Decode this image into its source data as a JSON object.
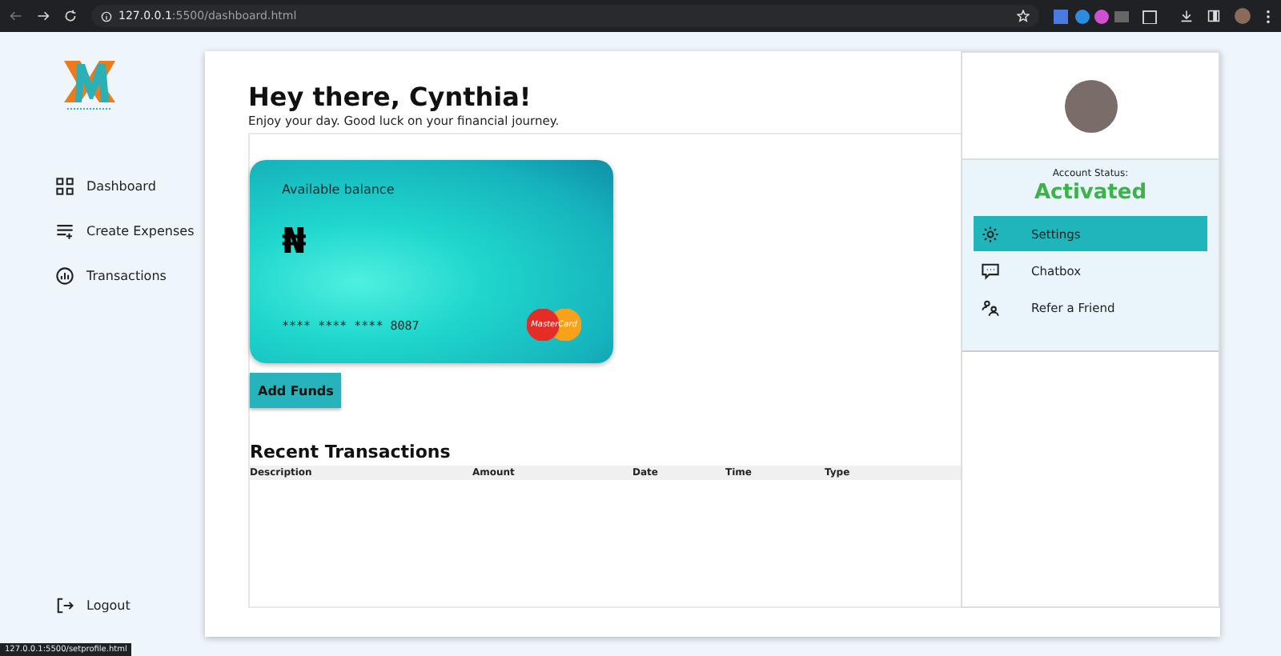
{
  "browser": {
    "url_host": "127.0.0.1",
    "url_path": ":5500/dashboard.html"
  },
  "sidebar": {
    "items": [
      {
        "label": "Dashboard"
      },
      {
        "label": "Create Expenses"
      },
      {
        "label": "Transactions"
      }
    ],
    "logout": {
      "label": "Logout"
    }
  },
  "greeting": {
    "title": "Hey there, Cynthia!",
    "subtitle": "Enjoy your day. Good luck on your financial journey."
  },
  "card": {
    "label": "Available balance",
    "currency": "₦",
    "number": "**** **** **** 8087",
    "brand": "MasterCard"
  },
  "add_funds": "Add Funds",
  "transactions": {
    "title": "Recent Transactions",
    "columns": [
      "Description",
      "Amount",
      "Date",
      "Time",
      "Type"
    ]
  },
  "profile": {
    "status_label": "Account Status:",
    "status": "Activated",
    "menu": [
      {
        "label": "Settings",
        "selected": true
      },
      {
        "label": "Chatbox",
        "selected": false
      },
      {
        "label": "Refer a Friend",
        "selected": false
      }
    ]
  },
  "status_bar": "127.0.0.1:5500/setprofile.html"
}
